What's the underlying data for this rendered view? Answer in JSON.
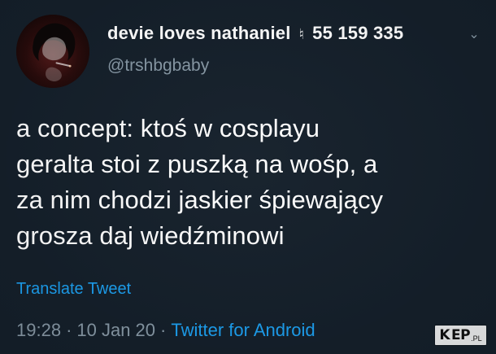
{
  "tweet": {
    "user": {
      "display_name": "devie loves nathaniel",
      "emoji": "♮",
      "follow_count_text": "55 159 335",
      "username": "@trshbgbaby",
      "avatar_icon": "avatar-icon"
    },
    "content": {
      "text": "a concept: ktoś w cosplayu\ngeralta stoi z puszką na wośp, a\nza nim chodzi jaskier śpiewający\ngrosza daj wiedźminowi"
    },
    "actions": {
      "translate_label": "Translate Tweet",
      "more_icon": "chevron-down-icon"
    },
    "meta": {
      "time": "19:28",
      "date": "10 Jan 20",
      "source": "Twitter for Android"
    }
  },
  "watermark": {
    "brand_left": "K",
    "brand_right": "EP",
    "brand_suffix": ".PL"
  },
  "theme": {
    "background": "#15202b",
    "text_primary": "#ffffff",
    "text_secondary": "#8899a6",
    "accent": "#1da1f2"
  }
}
